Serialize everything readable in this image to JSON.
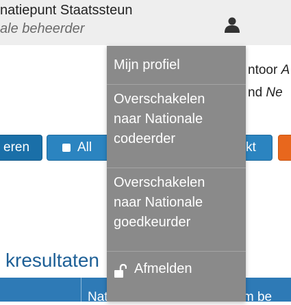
{
  "header": {
    "title": "natiepunt Staatssteun",
    "role": "ale beheerder",
    "user_icon": "user-icon"
  },
  "info": {
    "line1_text": "ntoor ",
    "line1_em": "A",
    "line2_text": "nd ",
    "line2_em": "Ne"
  },
  "toolbar": {
    "left_button_label": "eren",
    "all_button_label": "All",
    "akt_button_label": "kt"
  },
  "results": {
    "title": "kresultaten",
    "columns": [
      "",
      "Nationale ID",
      "Naam be"
    ]
  },
  "user_menu": {
    "items": [
      {
        "label": "Mijn profiel"
      },
      {
        "label_lines": [
          "Overschakelen",
          "naar Nationale",
          "codeerder"
        ]
      },
      {
        "label_lines": [
          "Overschakelen",
          "naar Nationale",
          "goedkeurder"
        ]
      }
    ],
    "logout_label": "Afmelden",
    "logout_icon": "unlock-icon"
  },
  "colors": {
    "header_bg": "#eeeeee",
    "menu_bg": "#8a8a8a",
    "primary_button": "#2b84c0",
    "accent_orange": "#e8671d",
    "table_header": "#2e7ab6",
    "title_blue": "#1d5f96"
  }
}
